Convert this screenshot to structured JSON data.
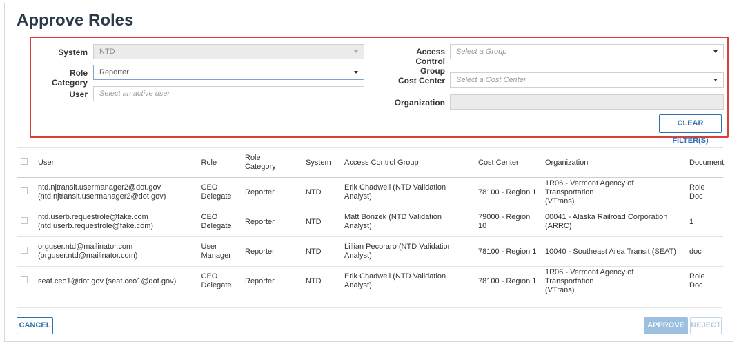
{
  "page": {
    "title": "Approve Roles"
  },
  "filters": {
    "system_label": "System",
    "system_value": "NTD",
    "role_category_label": "Role Category",
    "role_category_value": "Reporter",
    "user_label": "User",
    "user_placeholder": "Select an active user",
    "access_control_label_line1": "Access Control",
    "access_control_label_line2": "Group",
    "access_control_placeholder": "Select a Group",
    "cost_center_label": "Cost Center",
    "cost_center_placeholder": "Select a Cost Center",
    "organization_label": "Organization",
    "organization_value": "",
    "clear_filters_label": "CLEAR FILTER(S)"
  },
  "table": {
    "headers": {
      "user": "User",
      "role": "Role",
      "role_category_line1": "Role",
      "role_category_line2": "Category",
      "system": "System",
      "access_control_group": "Access Control Group",
      "cost_center": "Cost Center",
      "organization": "Organization",
      "document": "Document"
    },
    "rows": [
      {
        "user_line1": "ntd.njtransit.usermanager2@dot.gov",
        "user_line2": "(ntd.njtransit.usermanager2@dot.gov)",
        "role_line1": "CEO Delegate",
        "role_line2": "",
        "role_category": "Reporter",
        "system": "NTD",
        "acg_line1": "Erik Chadwell (NTD Validation Analyst)",
        "acg_line2": "",
        "cost_center_line1": "78100 - Region 1",
        "cost_center_line2": "",
        "org_line1": "1R06 - Vermont Agency of Transportation",
        "org_line2": "(VTrans)",
        "document": "Role Doc"
      },
      {
        "user_line1": "ntd.userb.requestrole@fake.com",
        "user_line2": "(ntd.userb.requestrole@fake.com)",
        "role_line1": "CEO Delegate",
        "role_line2": "",
        "role_category": "Reporter",
        "system": "NTD",
        "acg_line1": "Matt Bonzek (NTD Validation Analyst)",
        "acg_line2": "",
        "cost_center_line1": "79000 - Region",
        "cost_center_line2": "10",
        "org_line1": "00041 - Alaska Railroad Corporation",
        "org_line2": "(ARRC)",
        "document": "1"
      },
      {
        "user_line1": "orguser.ntd@mailinator.com",
        "user_line2": "(orguser.ntd@mailinator.com)",
        "role_line1": "User",
        "role_line2": "Manager",
        "role_category": "Reporter",
        "system": "NTD",
        "acg_line1": "Lillian Pecoraro (NTD Validation",
        "acg_line2": "Analyst)",
        "cost_center_line1": "78100 - Region 1",
        "cost_center_line2": "",
        "org_line1": "10040 - Southeast Area Transit (SEAT)",
        "org_line2": "",
        "document": "doc"
      },
      {
        "user_line1": "seat.ceo1@dot.gov (seat.ceo1@dot.gov)",
        "user_line2": "",
        "role_line1": "CEO Delegate",
        "role_line2": "",
        "role_category": "Reporter",
        "system": "NTD",
        "acg_line1": "Erik Chadwell (NTD Validation Analyst)",
        "acg_line2": "",
        "cost_center_line1": "78100 - Region 1",
        "cost_center_line2": "",
        "org_line1": "1R06 - Vermont Agency of Transportation",
        "org_line2": "(VTrans)",
        "document": "Role Doc"
      }
    ]
  },
  "footer": {
    "cancel_label": "CANCEL",
    "approve_label": "APPROVE",
    "reject_label": "REJECT"
  },
  "colors": {
    "filter_border": "#d9403a",
    "primary": "#2f6fb0",
    "disabled_primary": "#9dbfe0"
  }
}
